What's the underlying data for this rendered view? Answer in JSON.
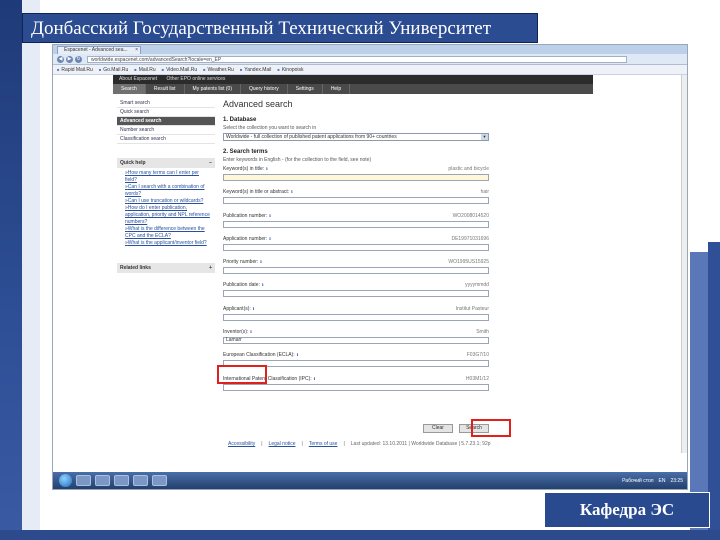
{
  "slide": {
    "title": "Донбасский Государственный Технический Университет",
    "footer": "Кафедра ЭС"
  },
  "browser": {
    "tab_title": "Espacenet - Advanced sea...",
    "url": "worldwide.espacenet.com/advancedSearch?locale=en_EP",
    "bookmarks": [
      "Rapid Mail.Ru",
      "Go.Mail.Ru",
      "Mail.Ru",
      "Video.Mail.Ru",
      "Weather.Ru",
      "Yandex.Mail",
      "Kinopoisk"
    ]
  },
  "site": {
    "top_links": [
      "About Espacenet",
      "Other EPO online services"
    ],
    "nav": [
      "Search",
      "Result list",
      "My patents list (0)",
      "Query history",
      "Settings",
      "Help"
    ],
    "left_menu": [
      "Smart search",
      "Quick search",
      "Advanced search",
      "Number search",
      "Classification search"
    ],
    "quick_help_title": "Quick help",
    "quick_help_items": [
      "How many terms can I enter per field?",
      "Can I search with a combination of words?",
      "Can I use truncation or wildcards?",
      "How do I enter publication, application, priority and NPL reference numbers?",
      "What is the difference between the CPC and the ECLA?",
      "What is the applicant/inventor field?"
    ],
    "related_links_title": "Related links",
    "heading": "Advanced search",
    "section1_title": "1. Database",
    "section1_desc": "Select the collection you want to search in",
    "database_value": "Worldwide - full collection of published patent applications from 90+ countries",
    "section2_title": "2. Search terms",
    "section2_desc": "Enter keywords in English - (for the collection to the field, see note)",
    "fields": [
      {
        "label": "Keyword(s) in title:",
        "example": "plastic and bicycle",
        "value": ""
      },
      {
        "label": "Keyword(s) in title or abstract:",
        "example": "hair",
        "value": ""
      },
      {
        "label": "Publication number:",
        "example": "WO2008014520",
        "value": ""
      },
      {
        "label": "Application number:",
        "example": "DE19971031696",
        "value": ""
      },
      {
        "label": "Priority number:",
        "example": "WO1995US15925",
        "value": ""
      },
      {
        "label": "Publication date:",
        "example": "yyyymmdd",
        "value": ""
      },
      {
        "label": "Applicant(s):",
        "example": "Institut Pasteur",
        "value": ""
      },
      {
        "label": "Inventor(s):",
        "example": "Smith",
        "value": "Lamarr"
      },
      {
        "label": "European Classification (ECLA):",
        "example": "F03G7/10",
        "value": ""
      },
      {
        "label": "International Patent Classification (IPC):",
        "example": "H03M1/12",
        "value": ""
      }
    ],
    "clear_label": "Clear",
    "search_label": "Search",
    "footer_links": [
      "Accessibility",
      "Legal notice",
      "Terms of use"
    ],
    "footer_text": "Last updated: 13.10.2011  |  Worldwide Database  |  5.7.23.1; 92p"
  },
  "taskbar": {
    "tray_text": "Рабочий стол",
    "lang": "EN",
    "time": "23:25"
  }
}
